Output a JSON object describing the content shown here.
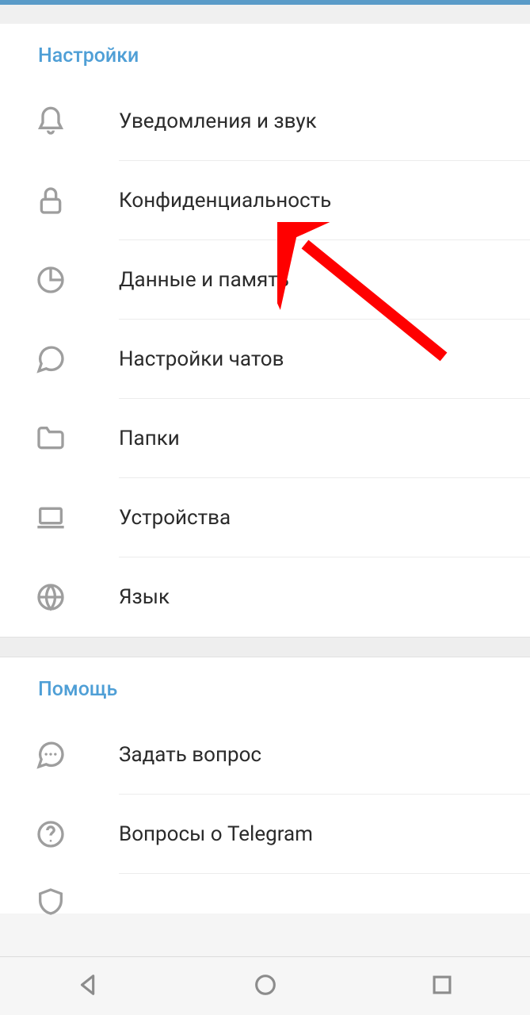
{
  "colors": {
    "accent": "#4f9fd6",
    "topbar": "#5a9bc8",
    "arrow": "#ff0000"
  },
  "sections": {
    "settings": {
      "title": "Настройки",
      "items": [
        {
          "label": "Уведомления и звук",
          "icon": "bell-icon"
        },
        {
          "label": "Конфиденциальность",
          "icon": "lock-icon"
        },
        {
          "label": "Данные и память",
          "icon": "pie-icon"
        },
        {
          "label": "Настройки чатов",
          "icon": "chat-icon"
        },
        {
          "label": "Папки",
          "icon": "folder-icon"
        },
        {
          "label": "Устройства",
          "icon": "laptop-icon"
        },
        {
          "label": "Язык",
          "icon": "globe-icon"
        }
      ]
    },
    "help": {
      "title": "Помощь",
      "items": [
        {
          "label": "Задать вопрос",
          "icon": "chat-dots-icon"
        },
        {
          "label": "Вопросы о Telegram",
          "icon": "question-icon"
        }
      ]
    }
  }
}
